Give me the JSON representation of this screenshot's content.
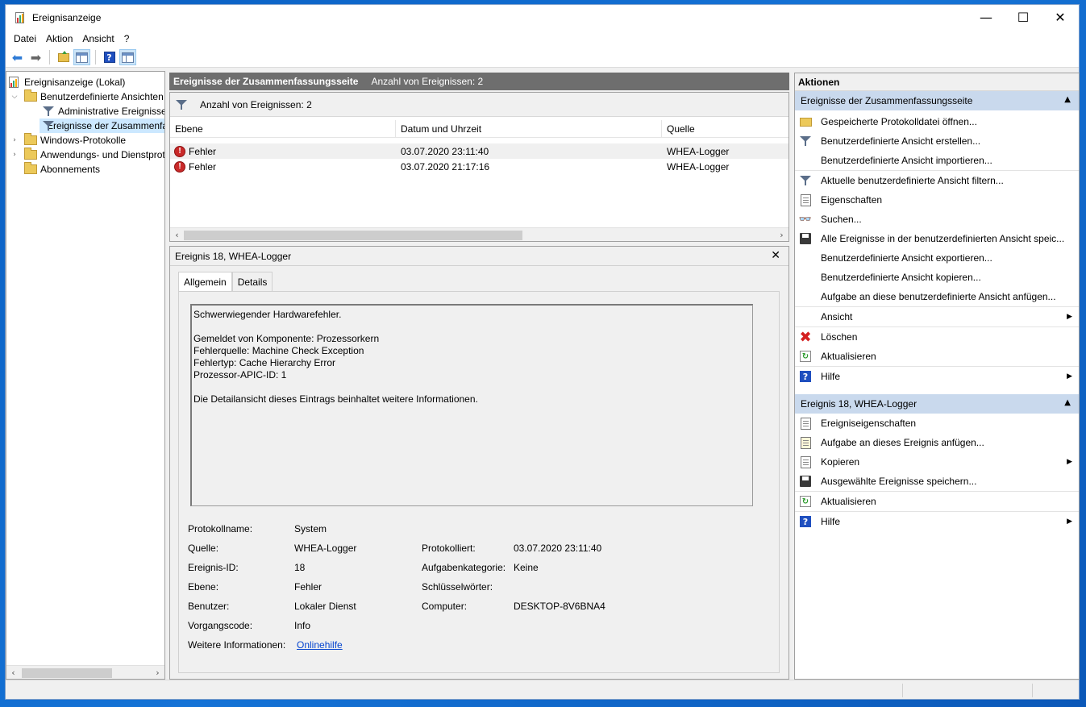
{
  "window": {
    "title": "Ereignisanzeige",
    "controls": {
      "minimize": "—",
      "maximize": "☐",
      "close": "✕"
    }
  },
  "menu": [
    "Datei",
    "Aktion",
    "Ansicht",
    "?"
  ],
  "toolbar": {
    "icons": [
      "back-arrow-icon",
      "forward-arrow-icon",
      "folder-up-icon",
      "show-hide-tree-icon",
      "help-icon",
      "show-hide-actions-icon"
    ]
  },
  "tree": {
    "root": "Ereignisanzeige (Lokal)",
    "custom_views": "Benutzerdefinierte Ansichten",
    "admin_events": "Administrative Ereignisse",
    "summary_events": "Ereignisse der Zusammenfassungsseite",
    "windows_logs": "Windows-Protokolle",
    "app_logs": "Anwendungs- und Dienstprotokolle",
    "subscriptions": "Abonnements"
  },
  "center": {
    "header_title": "Ereignisse der Zusammenfassungsseite",
    "header_count": "Anzahl von Ereignissen: 2",
    "filter_count": "Anzahl von Ereignissen: 2",
    "columns": {
      "level": "Ebene",
      "datetime": "Datum und Uhrzeit",
      "source": "Quelle"
    },
    "events": [
      {
        "level": "Fehler",
        "datetime": "03.07.2020 23:11:40",
        "source": "WHEA-Logger"
      },
      {
        "level": "Fehler",
        "datetime": "03.07.2020 21:17:16",
        "source": "WHEA-Logger"
      }
    ]
  },
  "detail": {
    "title": "Ereignis 18, WHEA-Logger",
    "tabs": {
      "general": "Allgemein",
      "details": "Details"
    },
    "description": "Schwerwiegender Hardwarefehler.\n\nGemeldet von Komponente: Prozessorkern\nFehlerquelle: Machine Check Exception\nFehlertyp: Cache Hierarchy Error\nProzessor-APIC-ID: 1\n\nDie Detailansicht dieses Eintrags beinhaltet weitere Informationen.",
    "labels": {
      "log_name": "Protokollname:",
      "source": "Quelle:",
      "event_id": "Ereignis-ID:",
      "level": "Ebene:",
      "user": "Benutzer:",
      "opcode": "Vorgangscode:",
      "more_info": "Weitere Informationen:",
      "logged": "Protokolliert:",
      "task_category": "Aufgabenkategorie:",
      "keywords": "Schlüsselwörter:",
      "computer": "Computer:"
    },
    "values": {
      "log_name": "System",
      "source": "WHEA-Logger",
      "event_id": "18",
      "level": "Fehler",
      "user": "Lokaler Dienst",
      "opcode": "Info",
      "more_info": "Onlinehilfe",
      "logged": "03.07.2020 23:11:40",
      "task_category": "Keine",
      "keywords": "",
      "computer": "DESKTOP-8V6BNA4"
    }
  },
  "actions": {
    "title": "Aktionen",
    "section1": "Ereignisse der Zusammenfassungsseite",
    "section1_items": [
      "Gespeicherte Protokolldatei öffnen...",
      "Benutzerdefinierte Ansicht erstellen...",
      "Benutzerdefinierte Ansicht importieren...",
      "Aktuelle benutzerdefinierte Ansicht filtern...",
      "Eigenschaften",
      "Suchen...",
      "Alle Ereignisse in der benutzerdefinierten Ansicht speic...",
      "Benutzerdefinierte Ansicht exportieren...",
      "Benutzerdefinierte Ansicht kopieren...",
      "Aufgabe an diese benutzerdefinierte Ansicht anfügen...",
      "Ansicht",
      "Löschen",
      "Aktualisieren",
      "Hilfe"
    ],
    "section2": "Ereignis 18, WHEA-Logger",
    "section2_items": [
      "Ereigniseigenschaften",
      "Aufgabe an dieses Ereignis anfügen...",
      "Kopieren",
      "Ausgewählte Ereignisse speichern...",
      "Aktualisieren",
      "Hilfe"
    ]
  }
}
